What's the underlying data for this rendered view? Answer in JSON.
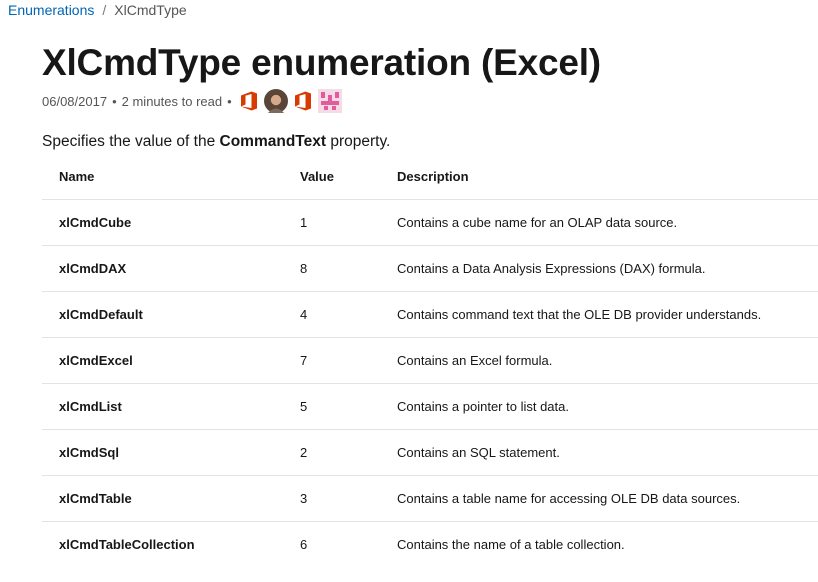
{
  "breadcrumb": {
    "parent": "Enumerations",
    "separator": "/",
    "current": "XlCmdType"
  },
  "page_title": "XlCmdType enumeration (Excel)",
  "meta": {
    "date": "06/08/2017",
    "bullet": "•",
    "read_time": "2 minutes to read"
  },
  "contributors": [
    "office-icon",
    "contributor-photo-avatar",
    "office-icon",
    "pink-identicon-avatar"
  ],
  "colors": {
    "link": "#0065b3",
    "office": "#d83b01",
    "identicon": "#e05c9c"
  },
  "lead": {
    "prefix": "Specifies the value of the",
    "property": "CommandText",
    "suffix": "property."
  },
  "table": {
    "headers": {
      "name": "Name",
      "value": "Value",
      "description": "Description"
    },
    "rows": [
      {
        "name": "xlCmdCube",
        "value": "1",
        "description": "Contains a cube name for an OLAP data source."
      },
      {
        "name": "xlCmdDAX",
        "value": "8",
        "description": "Contains a Data Analysis Expressions (DAX) formula."
      },
      {
        "name": "xlCmdDefault",
        "value": "4",
        "description": "Contains command text that the OLE DB provider understands."
      },
      {
        "name": "xlCmdExcel",
        "value": "7",
        "description": "Contains an Excel formula."
      },
      {
        "name": "xlCmdList",
        "value": "5",
        "description": "Contains a pointer to list data."
      },
      {
        "name": "xlCmdSql",
        "value": "2",
        "description": "Contains an SQL statement."
      },
      {
        "name": "xlCmdTable",
        "value": "3",
        "description": "Contains a table name for accessing OLE DB data sources."
      },
      {
        "name": "xlCmdTableCollection",
        "value": "6",
        "description": "Contains the name of a table collection."
      }
    ]
  }
}
